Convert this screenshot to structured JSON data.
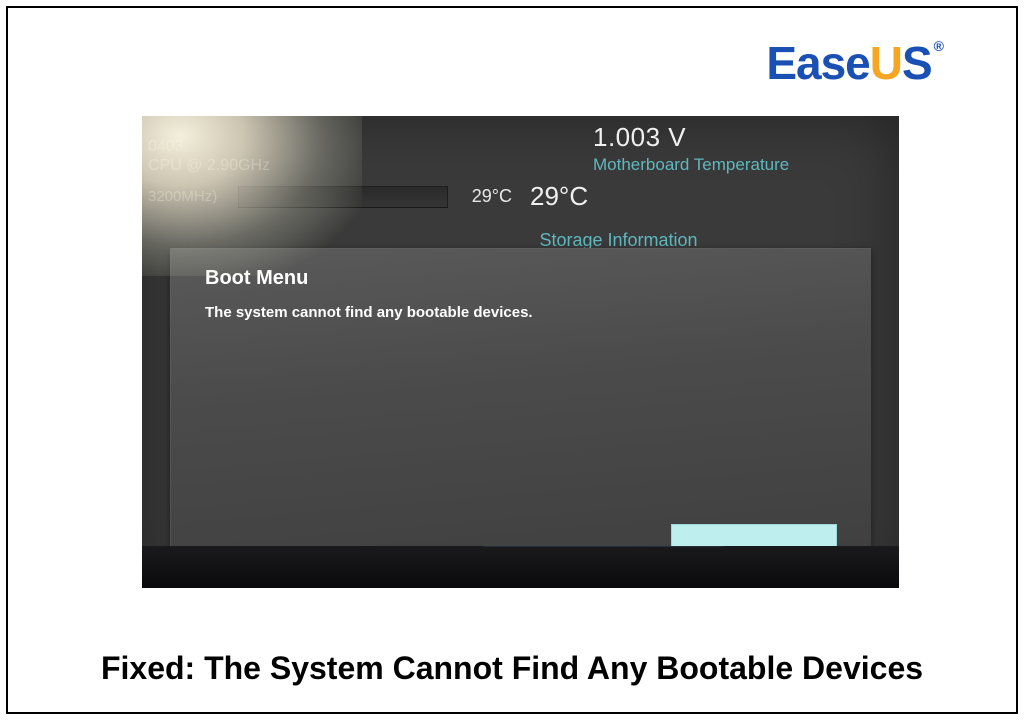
{
  "logo": {
    "part_blue_1": "Ease",
    "part_orange": "U",
    "part_blue_2": "S",
    "registered": "®"
  },
  "bios": {
    "cpu_line_partial_top": "0403",
    "cpu_line_partial": "CPU @ 2.90GHz",
    "memory_partial": "3200MHz)",
    "voltage": "1.003 V",
    "mb_temp_label": "Motherboard Temperature",
    "temp_small": "29°C",
    "temp_big": "29°C",
    "storage_label": "Storage Information"
  },
  "modal": {
    "title": "Boot Menu",
    "message": "The system cannot find any bootable devices."
  },
  "caption": "Fixed: The System Cannot Find Any Bootable Devices"
}
